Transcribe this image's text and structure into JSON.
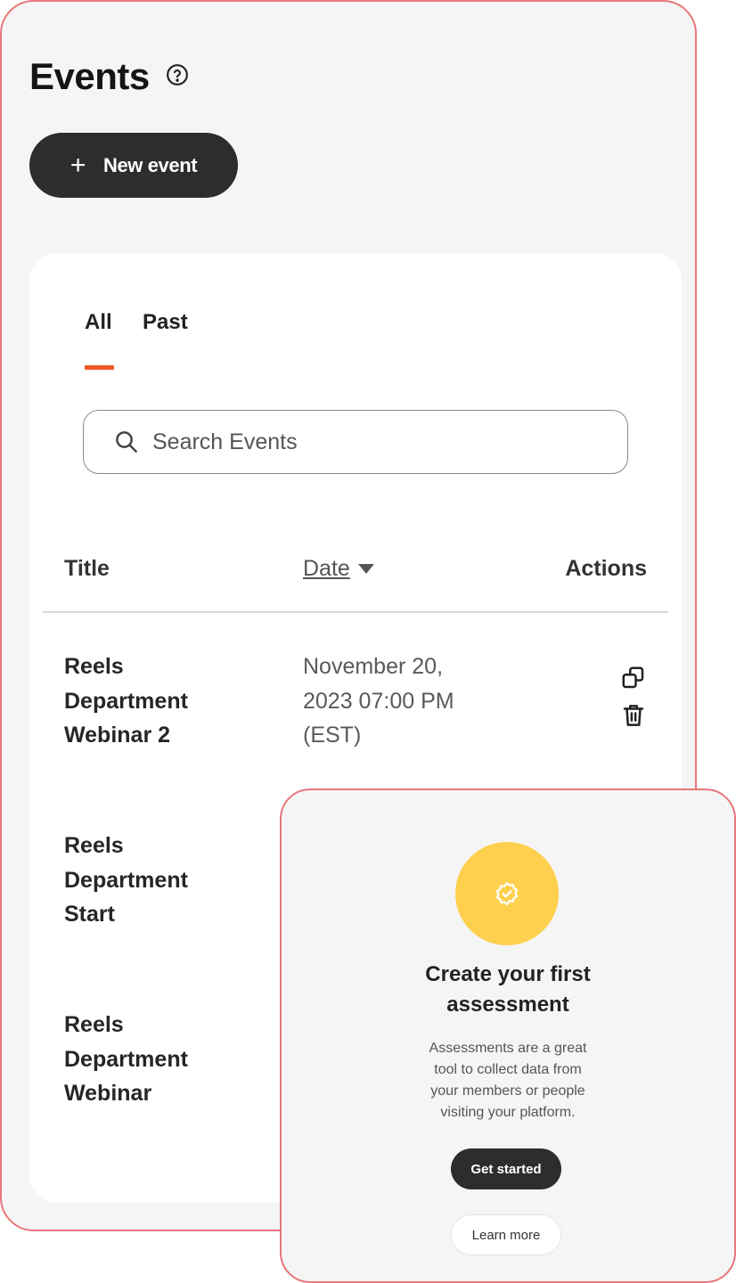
{
  "header": {
    "title": "Events",
    "help_icon": "help-circle-icon"
  },
  "new_event_button": {
    "icon": "plus-icon",
    "label": "New event"
  },
  "tabs": [
    {
      "label": "All",
      "active": true
    },
    {
      "label": "Past",
      "active": false
    }
  ],
  "search": {
    "placeholder": "Search Events",
    "value": ""
  },
  "table": {
    "columns": {
      "title": "Title",
      "date": "Date",
      "actions": "Actions"
    },
    "sort": {
      "column": "Date",
      "direction": "descending"
    },
    "rows": [
      {
        "title_lines": [
          "Reels",
          "Department",
          "Webinar 2"
        ],
        "date_lines": [
          "November 20,",
          "2023 07:00 PM",
          "(EST)"
        ],
        "actions": [
          "copy-icon",
          "trash-icon"
        ]
      },
      {
        "title_lines": [
          "Reels",
          "Department",
          "Start"
        ]
      },
      {
        "title_lines": [
          "Reels",
          "Department",
          "Webinar"
        ]
      }
    ]
  },
  "assessment_popup": {
    "icon": "verified-badge-icon",
    "title_lines": [
      "Create your first",
      "assessment"
    ],
    "description_lines": [
      "Assessments are a great",
      "tool to collect data from",
      "your members or people",
      "visiting your platform."
    ],
    "primary_button": "Get started",
    "secondary_button": "Learn more"
  },
  "colors": {
    "accent": "#f05a2a",
    "border_highlight": "#e8767c",
    "badge": "#ffd04d",
    "dark_button": "#2e2d2b"
  }
}
